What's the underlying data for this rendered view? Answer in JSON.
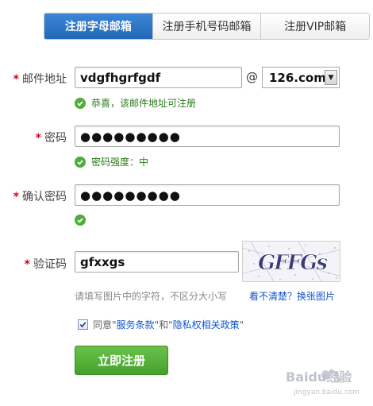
{
  "tabs": [
    {
      "label": "注册字母邮箱",
      "active": true
    },
    {
      "label": "注册手机号码邮箱",
      "active": false
    },
    {
      "label": "注册VIP邮箱",
      "active": false
    }
  ],
  "required_mark": "*",
  "email": {
    "label": "邮件地址",
    "value": "vdgfhgrfgdf",
    "at": "@",
    "domain": "126.com",
    "success": "恭喜，该邮件地址可注册",
    "success_icon": "check-circle-icon"
  },
  "password": {
    "label": "密码",
    "value": "●●●●●●●●●",
    "strength": "密码强度：中",
    "success_icon": "check-circle-icon"
  },
  "confirm_password": {
    "label": "确认密码",
    "value": "●●●●●●●●●",
    "success_icon": "check-circle-icon"
  },
  "captcha": {
    "label": "验证码",
    "value": "gfxxgs",
    "image_text": "GFFGs",
    "hint": "请填写图片中的字符，不区分大小写",
    "refresh_link": "看不清楚？换张图片"
  },
  "agreement": {
    "checked": true,
    "prefix": "同意",
    "quote_open": "\"",
    "quote_close": "\"",
    "terms": "服务条款",
    "and": "和",
    "privacy": "隐私权相关政策"
  },
  "submit_label": "立即注册",
  "watermark": {
    "brand": "Baidu经验",
    "url": "jingyan.baidu.com"
  },
  "colors": {
    "tab_active": "#2f78c8",
    "required": "#d0021b",
    "success": "#4caf3a",
    "link": "#1155cc",
    "button": "#4fae33"
  }
}
